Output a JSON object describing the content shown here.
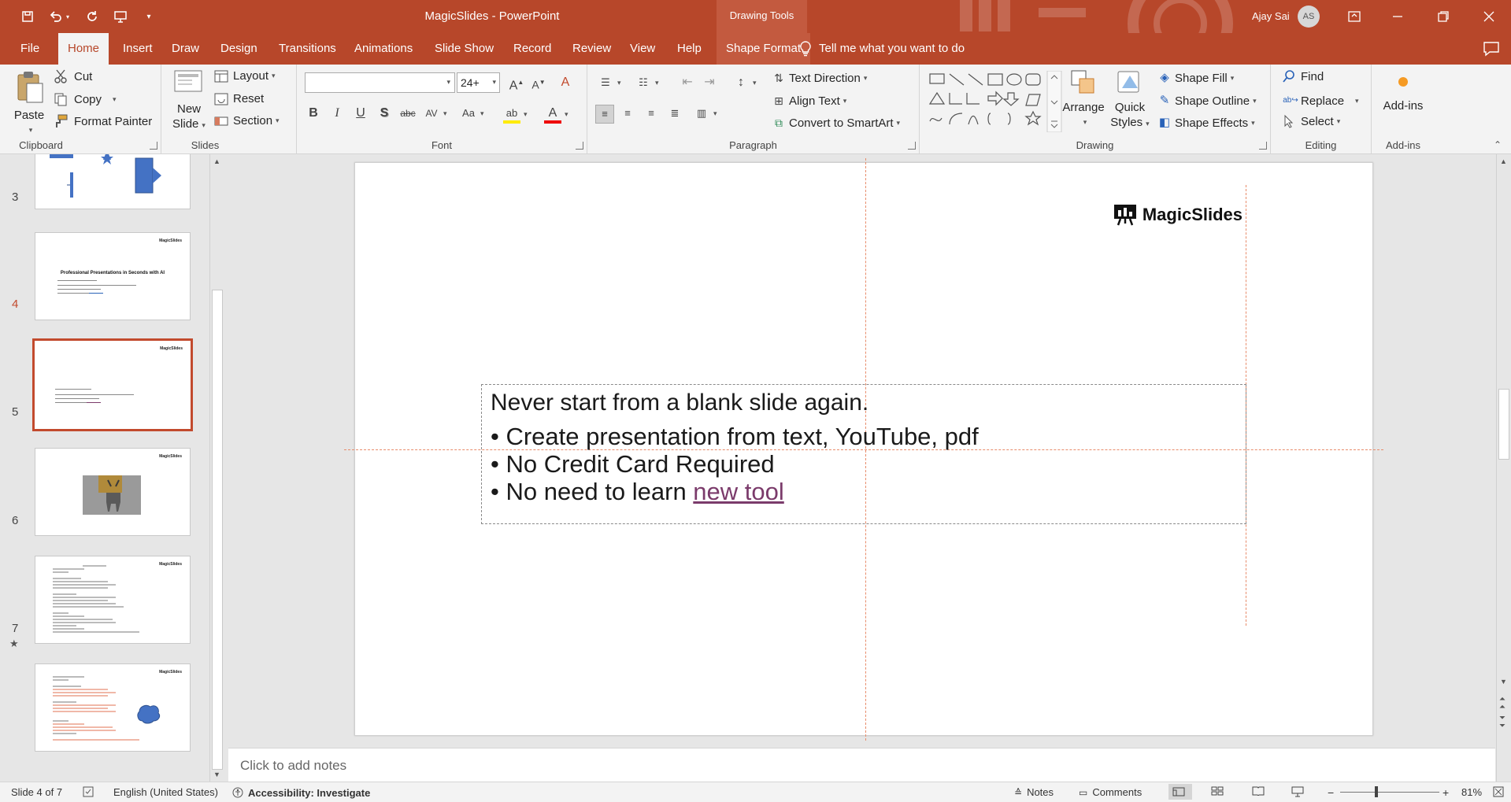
{
  "window": {
    "title": "MagicSlides  -  PowerPoint",
    "contextual_tab_group": "Drawing Tools",
    "user_name": "Ajay Sai",
    "user_initials": "AS"
  },
  "tabs": [
    "File",
    "Home",
    "Insert",
    "Draw",
    "Design",
    "Transitions",
    "Animations",
    "Slide Show",
    "Record",
    "Review",
    "View",
    "Help",
    "Shape Format"
  ],
  "active_tab": "Home",
  "tell_me": "Tell me what you want to do",
  "ribbon": {
    "clipboard": {
      "label": "Clipboard",
      "paste": "Paste",
      "cut": "Cut",
      "copy": "Copy",
      "format_painter": "Format Painter"
    },
    "slides": {
      "label": "Slides",
      "new_slide_1": "New",
      "new_slide_2": "Slide",
      "layout": "Layout",
      "reset": "Reset",
      "section": "Section"
    },
    "font": {
      "label": "Font",
      "font_name": "",
      "font_size": "24+"
    },
    "paragraph": {
      "label": "Paragraph",
      "text_direction": "Text Direction",
      "align_text": "Align Text",
      "convert_smartart": "Convert to SmartArt"
    },
    "drawing": {
      "label": "Drawing",
      "arrange": "Arrange",
      "quick_styles_1": "Quick",
      "quick_styles_2": "Styles",
      "shape_fill": "Shape Fill",
      "shape_outline": "Shape Outline",
      "shape_effects": "Shape Effects"
    },
    "editing": {
      "label": "Editing",
      "find": "Find",
      "replace": "Replace",
      "select": "Select"
    },
    "addins": {
      "label": "Add-ins",
      "addins": "Add-ins"
    }
  },
  "thumbnails": [
    {
      "number": "3",
      "title": "Professional Presentations in Seconds with AI",
      "logo": "MagicSlides"
    },
    {
      "number": "4",
      "logo": "MagicSlides",
      "selected": true
    },
    {
      "number": "5",
      "logo": "MagicSlides"
    },
    {
      "number": "6",
      "logo": "MagicSlides"
    },
    {
      "number": "7",
      "logo": "MagicSlides",
      "has_animation": true
    }
  ],
  "slide": {
    "logo_text": "MagicSlides",
    "heading": "Never start from a blank slide again.",
    "bullets": [
      {
        "text": "• Create presentation from text, YouTube, pdf"
      },
      {
        "text": "• No Credit Card Required"
      },
      {
        "prefix": "• No need to learn ",
        "link": "new tool"
      }
    ]
  },
  "notes_placeholder": "Click to add notes",
  "status": {
    "slide_info": "Slide 4 of 7",
    "language": "English (United States)",
    "accessibility": "Accessibility: Investigate",
    "notes": "Notes",
    "comments": "Comments",
    "zoom": "81%"
  },
  "colors": {
    "accent": "#b7472a",
    "selected_border": "#c24a2d",
    "link": "#7b3b6b"
  }
}
